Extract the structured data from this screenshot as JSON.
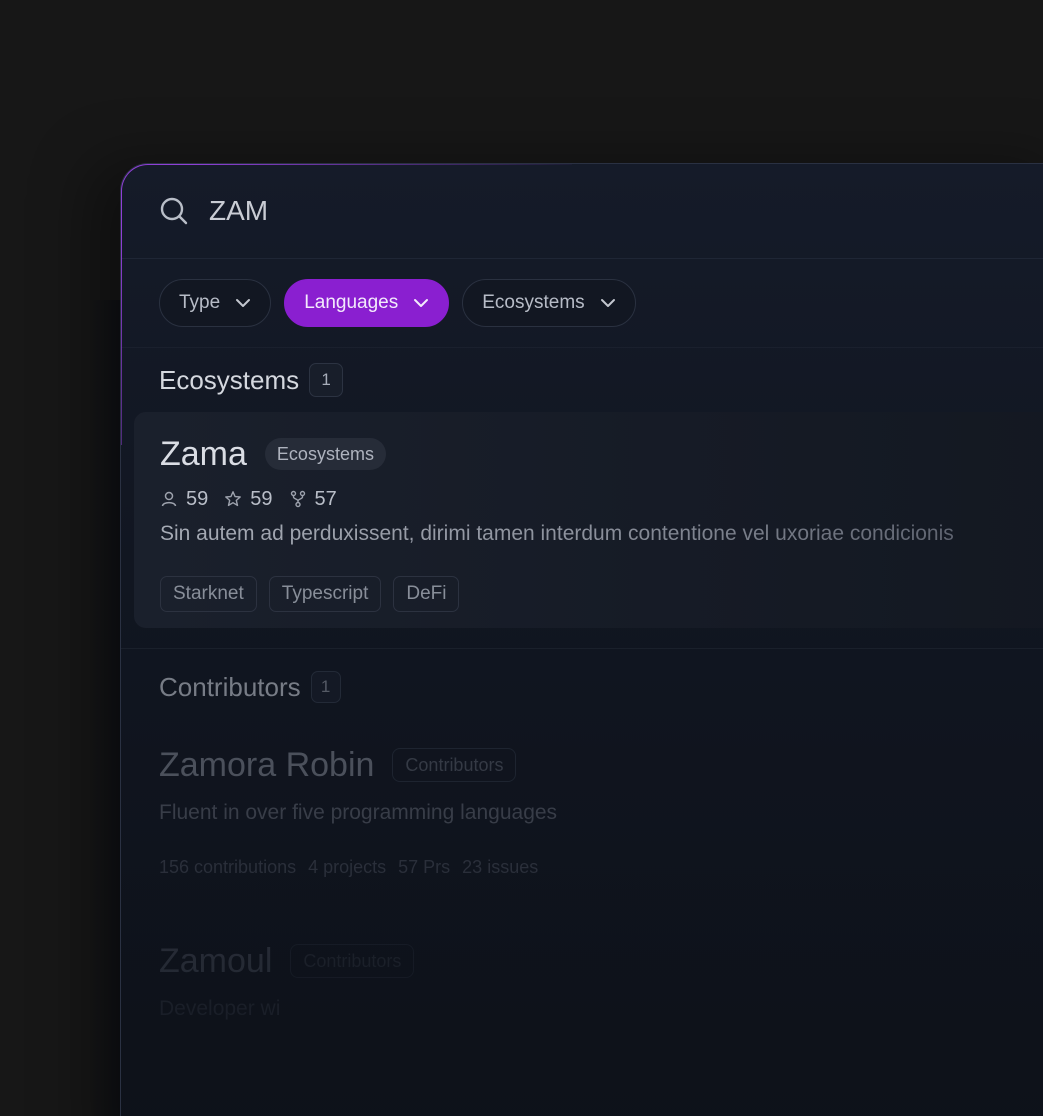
{
  "search": {
    "query": "ZAM"
  },
  "filters": [
    {
      "label": "Type",
      "active": false
    },
    {
      "label": "Languages",
      "active": true
    },
    {
      "label": "Ecosystems",
      "active": false
    }
  ],
  "ecosystems_section": {
    "title": "Ecosystems",
    "count": "1",
    "result": {
      "name": "Zama",
      "type_badge": "Ecosystems",
      "stats": {
        "contributors": "59",
        "stars": "59",
        "forks": "57"
      },
      "description": "Sin autem ad perduxissent, dirimi tamen interdum contentione vel uxoriae condicionis",
      "tags": [
        "Starknet",
        "Typescript",
        "DeFi"
      ]
    }
  },
  "contributors_section": {
    "title": "Contributors",
    "count": "1",
    "results": [
      {
        "name": "Zamora Robin",
        "type_badge": "Contributors",
        "description": "Fluent in over five programming languages",
        "stats": [
          "156 contributions",
          "4 projects",
          "57 Prs",
          "23 issues"
        ]
      },
      {
        "name": "Zamoul",
        "type_badge": "Contributors",
        "description": "Developer wi"
      }
    ]
  },
  "colors": {
    "accent": "#8a1fd0",
    "background": "#171717",
    "panel": "#131822"
  }
}
